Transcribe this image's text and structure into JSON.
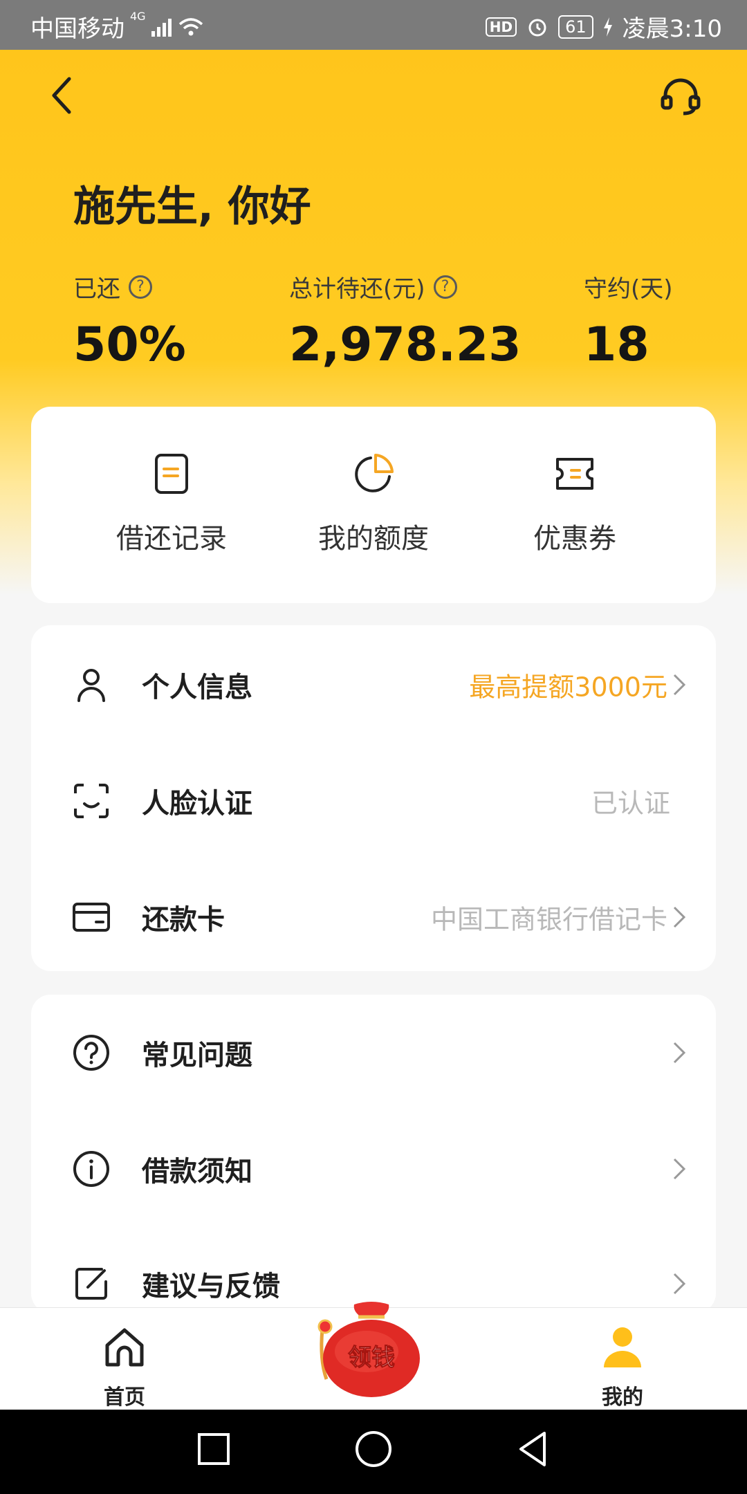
{
  "status_bar": {
    "carrier": "中国移动",
    "network": "4G",
    "hd": "HD",
    "battery": "61",
    "time": "凌晨3:10"
  },
  "header": {
    "greeting": "施先生, 你好"
  },
  "stats": [
    {
      "label": "已还",
      "value": "50%"
    },
    {
      "label": "总计待还(元)",
      "value": "2,978.23"
    },
    {
      "label": "守约(天)",
      "value": "18"
    }
  ],
  "quick_actions": [
    {
      "label": "借还记录",
      "icon": "document-icon"
    },
    {
      "label": "我的额度",
      "icon": "pie-chart-icon"
    },
    {
      "label": "优惠券",
      "icon": "coupon-icon"
    }
  ],
  "menu_group1": [
    {
      "title": "个人信息",
      "value": "最高提额3000元",
      "icon": "person-icon"
    },
    {
      "title": "人脸认证",
      "value": "已认证",
      "icon": "face-scan-icon"
    },
    {
      "title": "还款卡",
      "value": "中国工商银行借记卡",
      "icon": "card-icon"
    }
  ],
  "menu_group2": [
    {
      "title": "常见问题",
      "icon": "help-icon"
    },
    {
      "title": "借款须知",
      "icon": "info-icon"
    },
    {
      "title": "建议与反馈",
      "icon": "edit-icon"
    }
  ],
  "tabbar": {
    "home": "首页",
    "promo": "领钱",
    "mine": "我的"
  },
  "colors": {
    "accent": "#ffc41a",
    "orange_text": "#f5a623"
  }
}
